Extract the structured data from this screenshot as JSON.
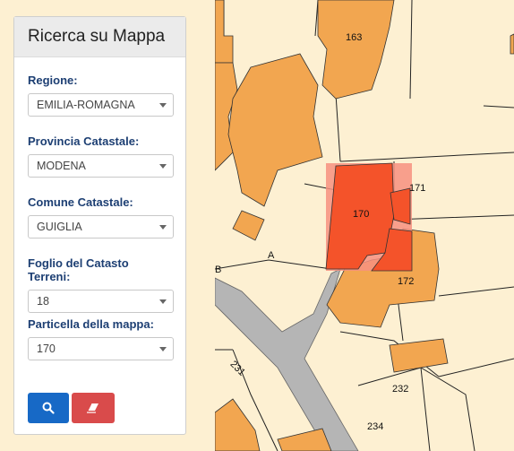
{
  "panel": {
    "title": "Ricerca su Mappa",
    "fields": [
      {
        "label": "Regione:",
        "value": "EMILIA-ROMAGNA"
      },
      {
        "label": "Provincia Catastale:",
        "value": "MODENA"
      },
      {
        "label": "Comune Catastale:",
        "value": "GUIGLIA"
      },
      {
        "label": "Foglio del Catasto Terreni:",
        "value": "18"
      },
      {
        "label": "Particella della mappa:",
        "value": "170"
      }
    ],
    "search_icon": "search-icon",
    "clear_icon": "eraser-icon"
  },
  "map": {
    "labels": {
      "p163": "163",
      "p170": "170",
      "p171": "171",
      "p172": "172",
      "pA": "A",
      "pB": "B",
      "p231": "231",
      "p232": "232",
      "p234": "234"
    }
  },
  "colors": {
    "parcel": "#fdf0d2",
    "building": "#f2a650",
    "highlight": "#f4532a",
    "road": "#b5b5b5",
    "label_blue": "#1d3f73",
    "search_button": "#1769c6",
    "clear_button": "#d94b4b"
  }
}
